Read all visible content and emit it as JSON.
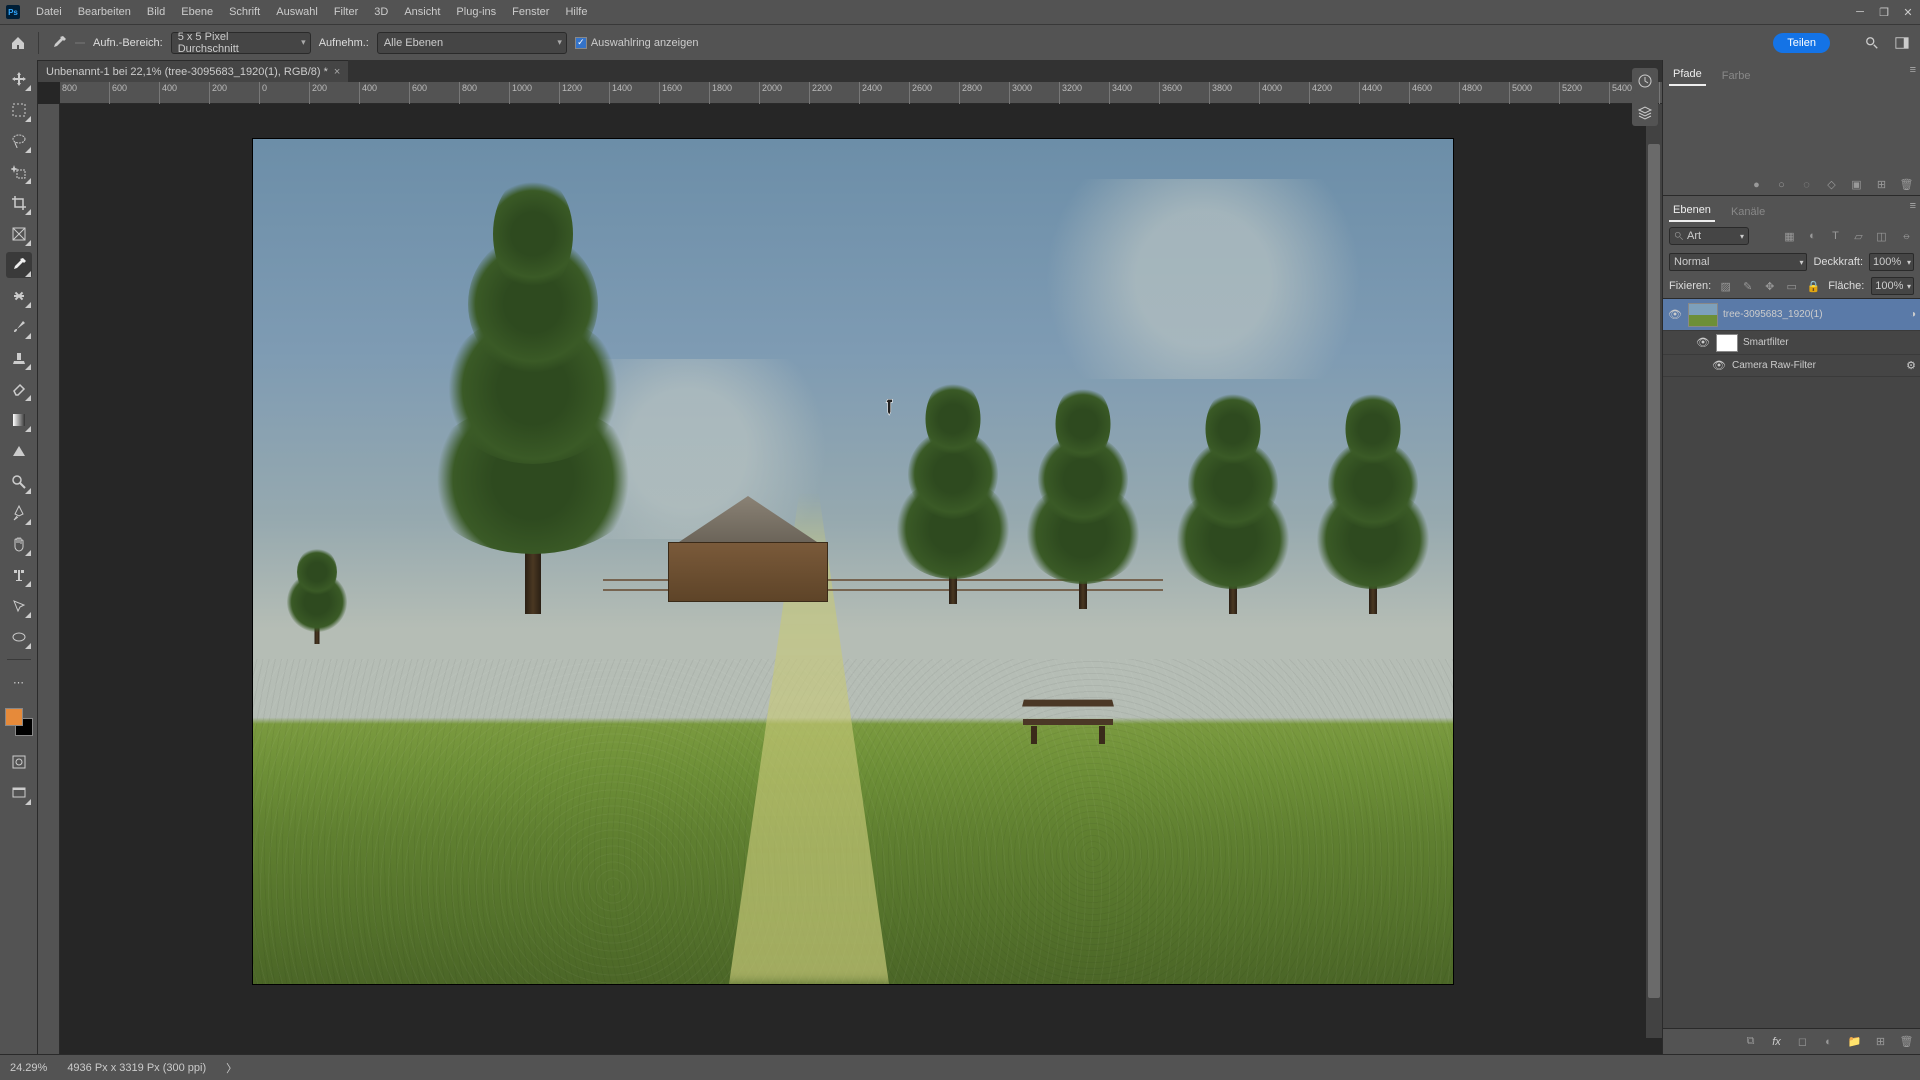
{
  "app": {
    "logo": "Ps"
  },
  "menu": [
    "Datei",
    "Bearbeiten",
    "Bild",
    "Ebene",
    "Schrift",
    "Auswahl",
    "Filter",
    "3D",
    "Ansicht",
    "Plug-ins",
    "Fenster",
    "Hilfe"
  ],
  "options": {
    "aufn_label": "Aufn.-Bereich:",
    "aufn_value": "5 x 5 Pixel Durchschnitt",
    "aufnehm_label": "Aufnehm.:",
    "aufnehm_value": "Alle Ebenen",
    "checkbox_label": "Auswahlring anzeigen",
    "share": "Teilen"
  },
  "document": {
    "tab_title": "Unbenannt-1 bei 22,1% (tree-3095683_1920(1), RGB/8) *"
  },
  "ruler_ticks": [
    "800",
    "600",
    "400",
    "200",
    "0",
    "200",
    "400",
    "600",
    "800",
    "1000",
    "1200",
    "1400",
    "1600",
    "1800",
    "2000",
    "2200",
    "2400",
    "2600",
    "2800",
    "3000",
    "3200",
    "3400",
    "3600",
    "3800",
    "4000",
    "4200",
    "4400",
    "4600",
    "4800",
    "5000",
    "5200",
    "5400"
  ],
  "panels": {
    "pfade_tab": "Pfade",
    "farbe_tab": "Farbe",
    "ebenen_tab": "Ebenen",
    "kanale_tab": "Kanäle",
    "search_placeholder": "Art",
    "blend_mode": "Normal",
    "opacity_label": "Deckkraft:",
    "opacity_value": "100%",
    "lock_label": "Fixieren:",
    "fill_label": "Fläche:",
    "fill_value": "100%",
    "layer_name": "tree-3095683_1920(1)",
    "smartfilter": "Smartfilter",
    "camera_raw": "Camera Raw-Filter"
  },
  "status": {
    "zoom": "24.29%",
    "doc_info": "4936 Px x 3319 Px (300 ppi)"
  },
  "colors": {
    "foreground": "#E68A3A",
    "background": "#000000"
  }
}
